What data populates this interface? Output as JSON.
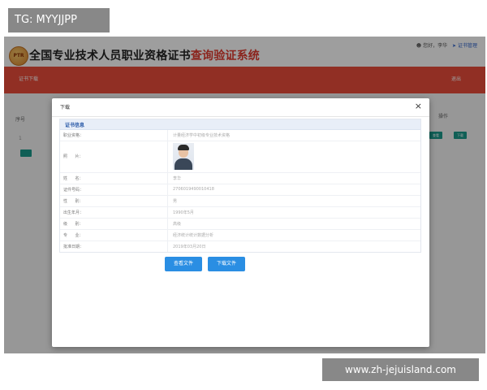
{
  "watermarks": {
    "top_left": "TG: MYYJJPP",
    "bottom_right": "www.zh-jejuisland.com"
  },
  "header": {
    "logo_text": "PTR",
    "title_main": "全国专业技术人员职业资格证书",
    "title_accent": "查询验证系统",
    "user_text": "您好，李华",
    "link_text": "证书管理"
  },
  "nav": {
    "tab_label": "证书下载",
    "logout_label": "退出"
  },
  "background_table": {
    "header_left": "序号",
    "header_right": "操作",
    "row_index": "1",
    "btn_view": "查看",
    "btn_download": "下载"
  },
  "modal": {
    "title": "下载",
    "close_glyph": "×",
    "section_title": "证书信息",
    "rows": [
      {
        "label": "职业资格：",
        "value": "计量经济学中初级专业技术资格"
      },
      {
        "label": "照      片：",
        "value": ""
      },
      {
        "label": "姓      名：",
        "value": "李华"
      },
      {
        "label": "证件号码：",
        "value": "2706019490010418"
      },
      {
        "label": "性      别：",
        "value": "男"
      },
      {
        "label": "出生年月：",
        "value": "1990年5月"
      },
      {
        "label": "级      别：",
        "value": "高级"
      },
      {
        "label": "专      业：",
        "value": "经济统计统计数据分析"
      },
      {
        "label": "批准日期：",
        "value": "2019年03月20日"
      }
    ],
    "btn_view": "查看文件",
    "btn_download": "下载文件"
  },
  "colors": {
    "nav_red": "#ea4c3a",
    "accent_blue": "#2a8ee3",
    "title_red": "#e03a2f",
    "teal": "#1a9a8c"
  }
}
